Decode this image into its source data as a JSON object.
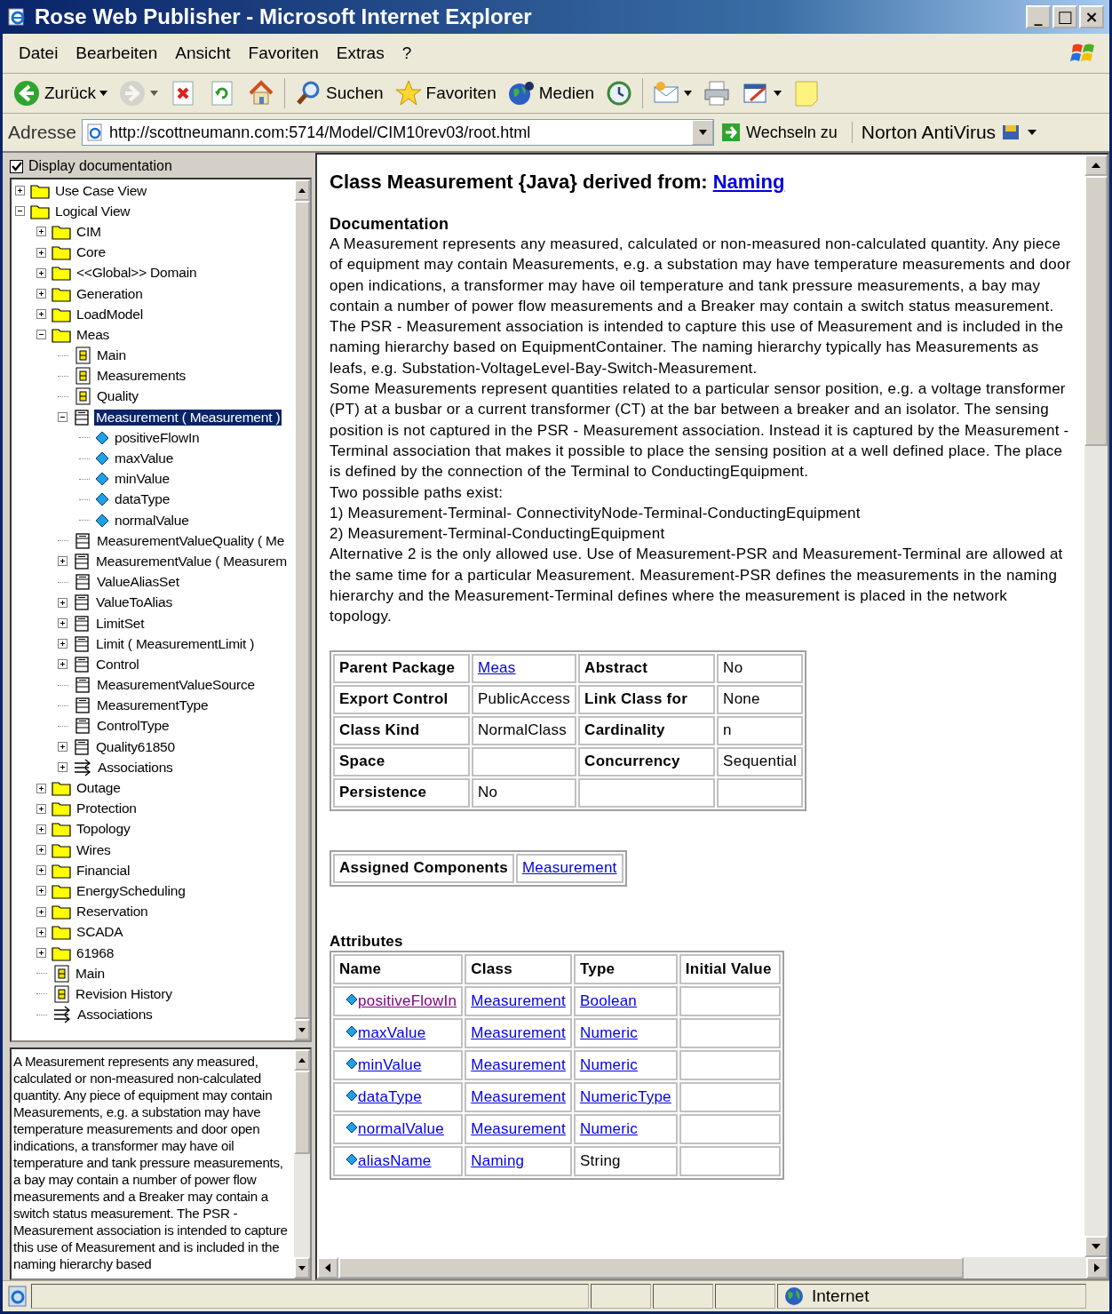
{
  "window": {
    "title": "Rose Web Publisher - Microsoft Internet Explorer",
    "controls": [
      "_",
      "□",
      "×"
    ]
  },
  "menu": [
    {
      "label": "Datei"
    },
    {
      "label": "Bearbeiten"
    },
    {
      "label": "Ansicht"
    },
    {
      "label": "Favoriten"
    },
    {
      "label": "Extras"
    },
    {
      "label": "?"
    }
  ],
  "toolbar": [
    [
      {
        "kind": "back",
        "label": "Zurück",
        "dropdown": true,
        "disabled": false
      },
      {
        "kind": "forward",
        "dropdown": true,
        "disabled": true
      },
      {
        "kind": "stop"
      },
      {
        "kind": "refresh"
      },
      {
        "kind": "home"
      }
    ],
    [
      {
        "kind": "search",
        "label": "Suchen"
      },
      {
        "kind": "favorites",
        "label": "Favoriten"
      },
      {
        "kind": "media",
        "label": "Medien"
      },
      {
        "kind": "history"
      }
    ],
    [
      {
        "kind": "mail",
        "dropdown": true
      },
      {
        "kind": "print"
      },
      {
        "kind": "edit",
        "dropdown": true
      },
      {
        "kind": "note"
      }
    ]
  ],
  "address": {
    "label": "Adresse",
    "value": "http://scottneumann.com:5714/Model/CIM10rev03/root.html",
    "go": "Wechseln zu",
    "addon": "Norton AntiVirus"
  },
  "sidebar": {
    "display_documentation": {
      "label": "Display documentation",
      "checked": true
    },
    "tree": [
      {
        "label": "Use Case View",
        "kind": "folder",
        "expanded": false,
        "selected": false
      },
      {
        "label": "Logical View",
        "kind": "folder",
        "expanded": true,
        "selected": false,
        "children": [
          {
            "label": "CIM",
            "kind": "folder",
            "expanded": false,
            "selected": false
          },
          {
            "label": "Core",
            "kind": "folder",
            "expanded": false,
            "selected": false
          },
          {
            "label": "<<Global>> Domain",
            "kind": "folder",
            "expanded": false,
            "selected": false
          },
          {
            "label": "Generation",
            "kind": "folder",
            "expanded": false,
            "selected": false
          },
          {
            "label": "LoadModel",
            "kind": "folder",
            "expanded": false,
            "selected": false
          },
          {
            "label": "Meas",
            "kind": "folder",
            "expanded": true,
            "selected": false,
            "children": [
              {
                "label": "Main",
                "kind": "diagram",
                "selected": false
              },
              {
                "label": "Measurements",
                "kind": "diagram",
                "selected": false
              },
              {
                "label": "Quality",
                "kind": "diagram",
                "selected": false
              },
              {
                "label": "Measurement ( Measurement )",
                "kind": "class",
                "expanded": true,
                "selected": true,
                "children": [
                  {
                    "label": "positiveFlowIn",
                    "kind": "attribute",
                    "selected": false
                  },
                  {
                    "label": "maxValue",
                    "kind": "attribute",
                    "selected": false
                  },
                  {
                    "label": "minValue",
                    "kind": "attribute",
                    "selected": false
                  },
                  {
                    "label": "dataType",
                    "kind": "attribute",
                    "selected": false
                  },
                  {
                    "label": "normalValue",
                    "kind": "attribute",
                    "selected": false
                  }
                ]
              },
              {
                "label": "MeasurementValueQuality ( Me",
                "kind": "class",
                "selected": false
              },
              {
                "label": "MeasurementValue ( Measurem",
                "kind": "class",
                "expanded": false,
                "selected": false
              },
              {
                "label": "ValueAliasSet",
                "kind": "class",
                "selected": false
              },
              {
                "label": "ValueToAlias",
                "kind": "class",
                "expanded": false,
                "selected": false
              },
              {
                "label": "LimitSet",
                "kind": "class",
                "expanded": false,
                "selected": false
              },
              {
                "label": "Limit ( MeasurementLimit )",
                "kind": "class",
                "expanded": false,
                "selected": false
              },
              {
                "label": "Control",
                "kind": "class",
                "expanded": false,
                "selected": false
              },
              {
                "label": "MeasurementValueSource",
                "kind": "class",
                "selected": false
              },
              {
                "label": "MeasurementType",
                "kind": "class",
                "selected": false
              },
              {
                "label": "ControlType",
                "kind": "class",
                "selected": false
              },
              {
                "label": "Quality61850",
                "kind": "class",
                "expanded": false,
                "selected": false
              },
              {
                "label": "Associations",
                "kind": "association",
                "expanded": false,
                "selected": false
              }
            ]
          },
          {
            "label": "Outage",
            "kind": "folder",
            "expanded": false,
            "selected": false
          },
          {
            "label": "Protection",
            "kind": "folder",
            "expanded": false,
            "selected": false
          },
          {
            "label": "Topology",
            "kind": "folder",
            "expanded": false,
            "selected": false
          },
          {
            "label": "Wires",
            "kind": "folder",
            "expanded": false,
            "selected": false
          },
          {
            "label": "Financial",
            "kind": "folder",
            "expanded": false,
            "selected": false
          },
          {
            "label": "EnergyScheduling",
            "kind": "folder",
            "expanded": false,
            "selected": false
          },
          {
            "label": "Reservation",
            "kind": "folder",
            "expanded": false,
            "selected": false
          },
          {
            "label": "SCADA",
            "kind": "folder",
            "expanded": false,
            "selected": false
          },
          {
            "label": "61968",
            "kind": "folder",
            "expanded": false,
            "selected": false
          },
          {
            "label": "Main",
            "kind": "diagram",
            "selected": false
          },
          {
            "label": "Revision History",
            "kind": "diagram",
            "selected": false
          },
          {
            "label": "Associations",
            "kind": "association",
            "selected": false
          }
        ]
      }
    ],
    "documentation": "A Measurement represents any measured, calculated or non-measured non-calculated quantity. Any piece of equipment may contain Measurements, e.g. a substation may have temperature measurements and door open indications, a transformer may have oil temperature and tank pressure measurements, a bay may contain a number of  power flow measurements and a Breaker may contain a switch status measurement. The PSR - Measurement association is intended to capture this use of Measurement and is included in the naming hierarchy based"
  },
  "content": {
    "heading": {
      "text": "Class Measurement {Java} derived from:",
      "link": "Naming"
    },
    "documentation_title": "Documentation",
    "documentation": [
      "A Measurement represents any measured, calculated or non-measured non-calculated quantity. Any piece of equipment may contain Measurements, e.g. a substation may have temperature measurements and door open indications, a transformer may have oil temperature and tank pressure measurements, a bay may contain a number of power flow measurements and a Breaker may contain a switch status measurement.",
      "The PSR - Measurement association is intended to capture this use of Measurement and is included in the naming hierarchy based on EquipmentContainer. The naming hierarchy typically has Measurements as leafs, e.g. Substation-VoltageLevel-Bay-Switch-Measurement.",
      "Some Measurements represent quantities related to a particular sensor position, e.g. a voltage transformer (PT) at a busbar or a current transformer (CT) at the bar between a breaker and an isolator. The sensing position is not captured in the PSR - Measurement association. Instead it is captured by the Measurement - Terminal association that makes it possible to place the sensing position at a well defined place. The place is defined by the connection of the Terminal to ConductingEquipment.",
      "Two possible paths exist:",
      "1) Measurement-Terminal- ConnectivityNode-Terminal-ConductingEquipment",
      "2) Measurement-Terminal-ConductingEquipment",
      "Alternative 2 is the only allowed use. Use of Measurement-PSR and Measurement-Terminal are allowed at the same time for a particular Measurement. Measurement-PSR defines the measurements in the naming hierarchy and the Measurement-Terminal defines where the measurement is placed in the network topology."
    ],
    "properties": [
      [
        {
          "text": "Parent Package",
          "kind": "label"
        },
        {
          "text": "Meas",
          "kind": "link"
        },
        {
          "text": "Abstract",
          "kind": "label"
        },
        {
          "text": "No",
          "kind": "value"
        }
      ],
      [
        {
          "text": "Export Control",
          "kind": "label"
        },
        {
          "text": "PublicAccess",
          "kind": "value"
        },
        {
          "text": "Link Class for",
          "kind": "label"
        },
        {
          "text": "None",
          "kind": "value"
        }
      ],
      [
        {
          "text": "Class Kind",
          "kind": "label"
        },
        {
          "text": "NormalClass",
          "kind": "value"
        },
        {
          "text": "Cardinality",
          "kind": "label"
        },
        {
          "text": "n",
          "kind": "value"
        }
      ],
      [
        {
          "text": "Space",
          "kind": "label"
        },
        {
          "kind": "value"
        },
        {
          "text": "Concurrency",
          "kind": "label"
        },
        {
          "text": "Sequential",
          "kind": "value"
        }
      ],
      [
        {
          "text": "Persistence",
          "kind": "label"
        },
        {
          "text": "No",
          "kind": "value"
        },
        {
          "kind": "label"
        },
        {
          "kind": "value"
        }
      ]
    ],
    "assigned_components": {
      "label": "Assigned Components",
      "link": "Measurement"
    },
    "attributes": {
      "title": "Attributes",
      "columns": [
        "Name",
        "Class",
        "Type",
        "Initial Value"
      ],
      "rows": [
        {
          "name": "positiveFlowIn",
          "visited": true,
          "class": "Measurement",
          "type": "Boolean",
          "type_link": true
        },
        {
          "name": "maxValue",
          "visited": false,
          "class": "Measurement",
          "type": "Numeric",
          "type_link": true
        },
        {
          "name": "minValue",
          "visited": false,
          "class": "Measurement",
          "type": "Numeric",
          "type_link": true
        },
        {
          "name": "dataType",
          "visited": false,
          "class": "Measurement",
          "type": "NumericType",
          "type_link": true
        },
        {
          "name": "normalValue",
          "visited": false,
          "class": "Measurement",
          "type": "Numeric",
          "type_link": true
        },
        {
          "name": "aliasName",
          "visited": false,
          "class": "Naming",
          "type": "String",
          "type_link": false
        }
      ]
    }
  },
  "status_bar": {
    "zone": "Internet"
  }
}
